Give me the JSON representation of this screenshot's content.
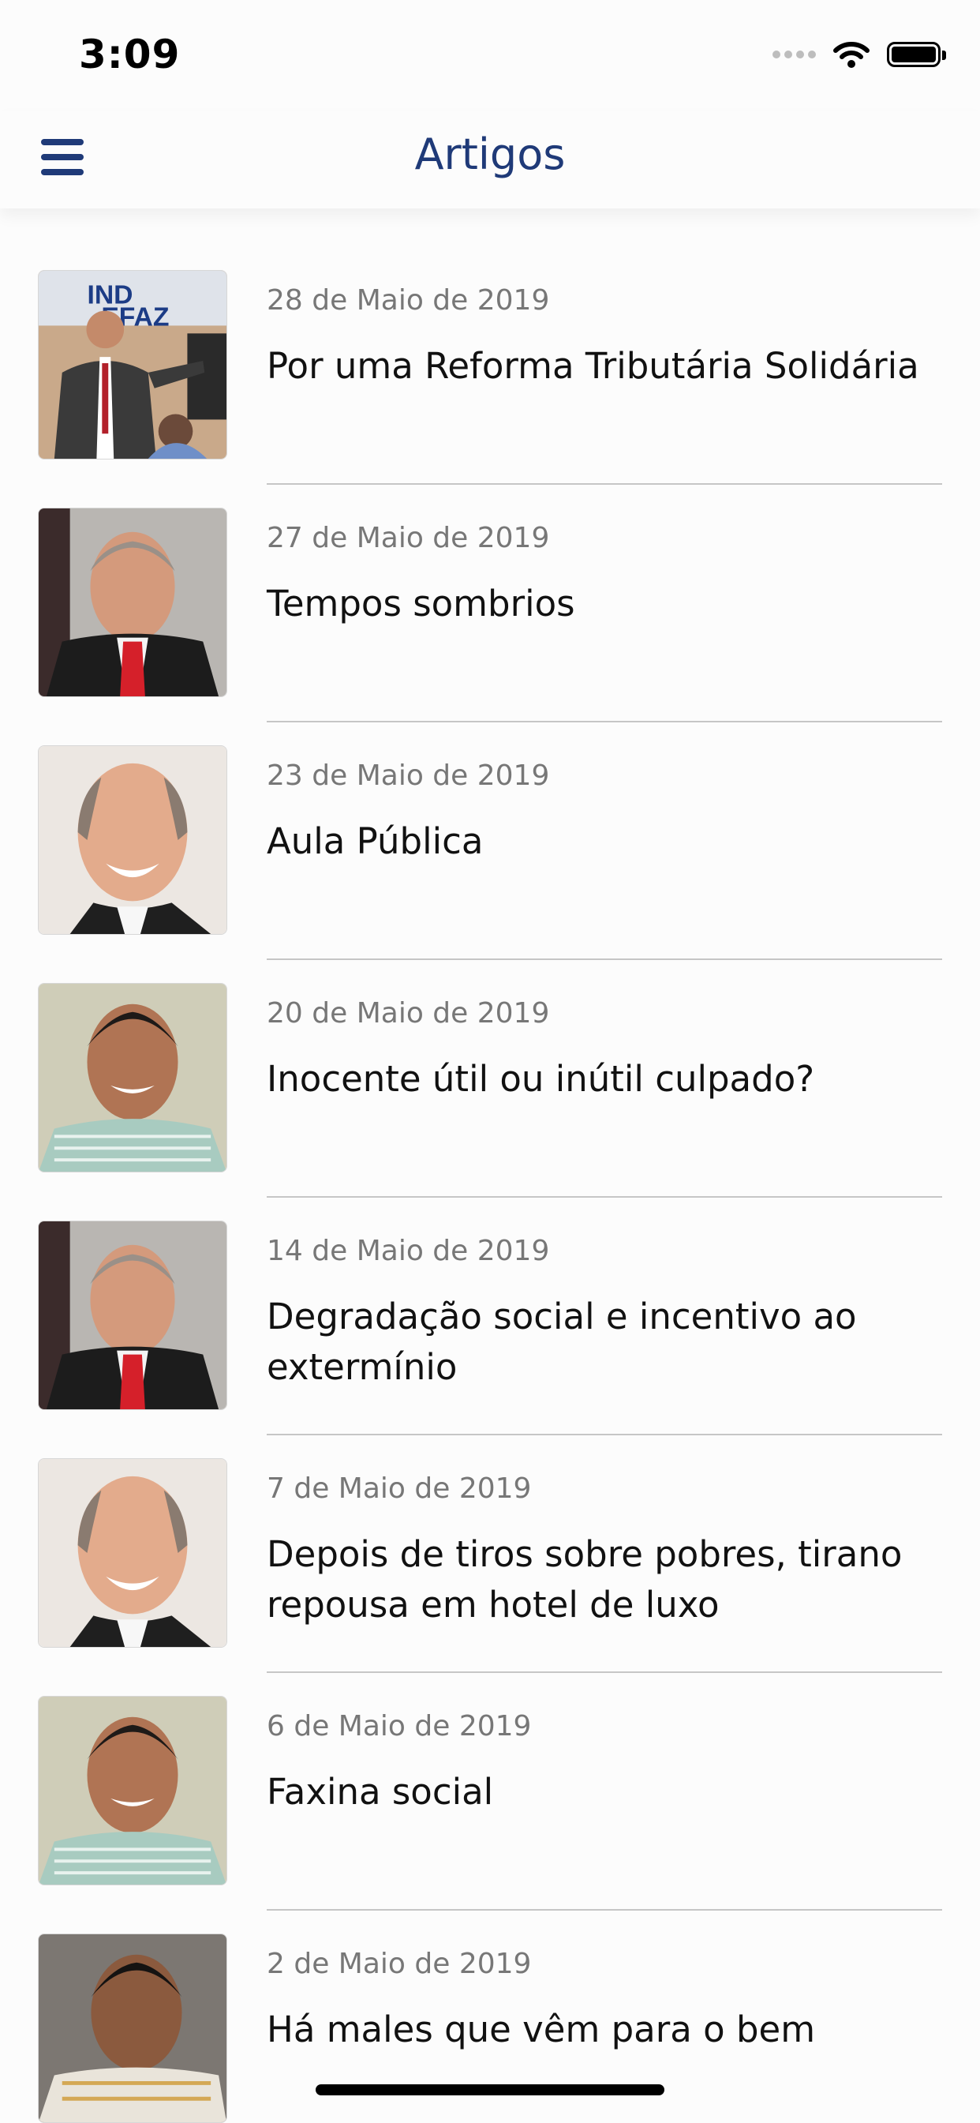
{
  "status_bar": {
    "time": "3:09",
    "icons": [
      "cellular-signal-icon",
      "wifi-icon",
      "battery-icon"
    ]
  },
  "nav": {
    "title": "Artigos",
    "menu_icon": "hamburger-menu-icon",
    "accent_color": "#1f3a78"
  },
  "articles": [
    {
      "date": "28 de Maio de 2019",
      "title": "Por uma Reforma Tributária Solidária",
      "thumbnail": "photo-speaker-at-event"
    },
    {
      "date": "27 de Maio de 2019",
      "title": "Tempos sombrios",
      "thumbnail": "photo-man-red-tie"
    },
    {
      "date": "23 de Maio de 2019",
      "title": "Aula Pública",
      "thumbnail": "photo-bald-man-smiling"
    },
    {
      "date": "20 de Maio de 2019",
      "title": "Inocente útil ou inútil culpado?",
      "thumbnail": "photo-man-striped-shirt"
    },
    {
      "date": "14 de Maio de 2019",
      "title": "Degradação social e incentivo ao extermínio",
      "thumbnail": "photo-man-red-tie"
    },
    {
      "date": "7 de Maio de 2019",
      "title": "Depois de tiros sobre pobres, tirano repousa em hotel de luxo",
      "thumbnail": "photo-bald-man-smiling"
    },
    {
      "date": "6 de Maio de 2019",
      "title": "Faxina social",
      "thumbnail": "photo-man-striped-shirt"
    },
    {
      "date": "2 de Maio de 2019",
      "title": "Há males que vêm para o bem",
      "thumbnail": "photo-man-interview"
    }
  ]
}
